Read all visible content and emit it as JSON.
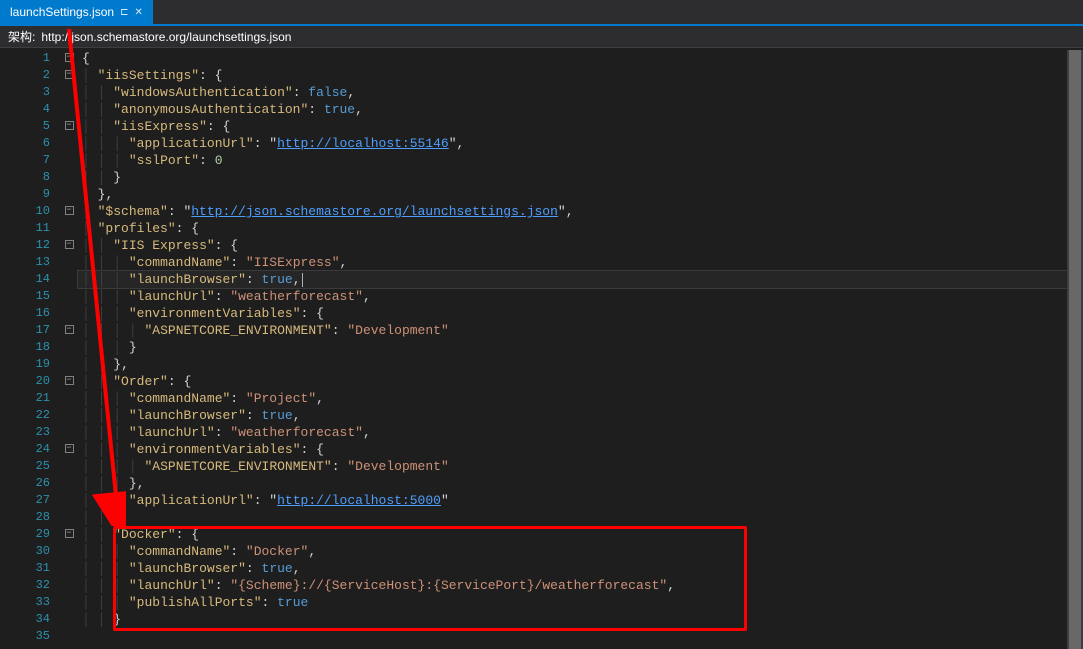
{
  "tab": {
    "filename": "launchSettings.json",
    "pin_glyph": "⊏",
    "close_glyph": "✕"
  },
  "schema_bar": {
    "label": "架构:",
    "url": "http://json.schemastore.org/launchsettings.json"
  },
  "line_numbers": [
    "1",
    "2",
    "3",
    "4",
    "5",
    "6",
    "7",
    "8",
    "9",
    "10",
    "11",
    "12",
    "13",
    "14",
    "15",
    "16",
    "17",
    "18",
    "19",
    "20",
    "21",
    "22",
    "23",
    "24",
    "25",
    "26",
    "27",
    "28",
    "29",
    "30",
    "31",
    "32",
    "33",
    "34",
    "35"
  ],
  "fold_rows": {
    "1": "-",
    "2": "-",
    "5": "-",
    "10": "-",
    "12": "-",
    "17": "-",
    "20": "-",
    "24": "-",
    "29": "-"
  },
  "code": {
    "l1": {
      "indent": "",
      "brace": "{"
    },
    "l2": {
      "indent": "  ",
      "key": "\"iisSettings\"",
      "sep": ": ",
      "brace": "{"
    },
    "l3": {
      "indent": "    ",
      "key": "\"windowsAuthentication\"",
      "sep": ": ",
      "val": "false",
      "tail": ","
    },
    "l4": {
      "indent": "    ",
      "key": "\"anonymousAuthentication\"",
      "sep": ": ",
      "val": "true",
      "tail": ","
    },
    "l5": {
      "indent": "    ",
      "key": "\"iisExpress\"",
      "sep": ": ",
      "brace": "{"
    },
    "l6": {
      "indent": "      ",
      "key": "\"applicationUrl\"",
      "sep": ": \"",
      "link": "http://localhost:55146",
      "tail": "\","
    },
    "l7": {
      "indent": "      ",
      "key": "\"sslPort\"",
      "sep": ": ",
      "num": "0"
    },
    "l8": {
      "indent": "    ",
      "brace": "}"
    },
    "l9": {
      "indent": "  ",
      "brace": "}",
      "tail": ","
    },
    "l10": {
      "indent": "  ",
      "key": "\"$schema\"",
      "sep": ": \"",
      "link": "http://json.schemastore.org/launchsettings.json",
      "tail": "\","
    },
    "l11": {
      "indent": "  ",
      "key": "\"profiles\"",
      "sep": ": ",
      "brace": "{"
    },
    "l12": {
      "indent": "    ",
      "key": "\"IIS Express\"",
      "sep": ": ",
      "brace": "{"
    },
    "l13": {
      "indent": "      ",
      "key": "\"commandName\"",
      "sep": ": ",
      "str": "\"IISExpress\"",
      "tail": ","
    },
    "l14": {
      "indent": "      ",
      "key": "\"launchBrowser\"",
      "sep": ": ",
      "val": "true",
      "tail": ","
    },
    "l15": {
      "indent": "      ",
      "key": "\"launchUrl\"",
      "sep": ": ",
      "str": "\"weatherforecast\"",
      "tail": ","
    },
    "l16": {
      "indent": "      ",
      "key": "\"environmentVariables\"",
      "sep": ": ",
      "brace": "{"
    },
    "l17": {
      "indent": "        ",
      "key": "\"ASPNETCORE_ENVIRONMENT\"",
      "sep": ": ",
      "str": "\"Development\""
    },
    "l18": {
      "indent": "      ",
      "brace": "}"
    },
    "l19": {
      "indent": "    ",
      "brace": "}",
      "tail": ","
    },
    "l20": {
      "indent": "    ",
      "key": "\"Order\"",
      "sep": ": ",
      "brace": "{"
    },
    "l21": {
      "indent": "      ",
      "key": "\"commandName\"",
      "sep": ": ",
      "str": "\"Project\"",
      "tail": ","
    },
    "l22": {
      "indent": "      ",
      "key": "\"launchBrowser\"",
      "sep": ": ",
      "val": "true",
      "tail": ","
    },
    "l23": {
      "indent": "      ",
      "key": "\"launchUrl\"",
      "sep": ": ",
      "str": "\"weatherforecast\"",
      "tail": ","
    },
    "l24": {
      "indent": "      ",
      "key": "\"environmentVariables\"",
      "sep": ": ",
      "brace": "{"
    },
    "l25": {
      "indent": "        ",
      "key": "\"ASPNETCORE_ENVIRONMENT\"",
      "sep": ": ",
      "str": "\"Development\""
    },
    "l26": {
      "indent": "      ",
      "brace": "}",
      "tail": ","
    },
    "l27": {
      "indent": "      ",
      "key": "\"applicationUrl\"",
      "sep": ": \"",
      "link": "http://localhost:5000",
      "tail": "\""
    },
    "l28": {
      "indent": "    ",
      "brace": "}",
      "tail": ","
    },
    "l29": {
      "indent": "    ",
      "key": "\"Docker\"",
      "sep": ": ",
      "brace": "{"
    },
    "l30": {
      "indent": "      ",
      "key": "\"commandName\"",
      "sep": ": ",
      "str": "\"Docker\"",
      "tail": ","
    },
    "l31": {
      "indent": "      ",
      "key": "\"launchBrowser\"",
      "sep": ": ",
      "val": "true",
      "tail": ","
    },
    "l32": {
      "indent": "      ",
      "key": "\"launchUrl\"",
      "sep": ": ",
      "str": "\"{Scheme}://{ServiceHost}:{ServicePort}/weatherforecast\"",
      "tail": ","
    },
    "l33": {
      "indent": "      ",
      "key": "\"publishAllPorts\"",
      "sep": ": ",
      "val": "true"
    },
    "l34": {
      "indent": "    ",
      "brace": "}"
    },
    "l35": {
      "indent": ""
    }
  },
  "current_line": 14,
  "annotation": {
    "arrow_color": "#ff0000",
    "box_label": "Docker profile highlight"
  }
}
